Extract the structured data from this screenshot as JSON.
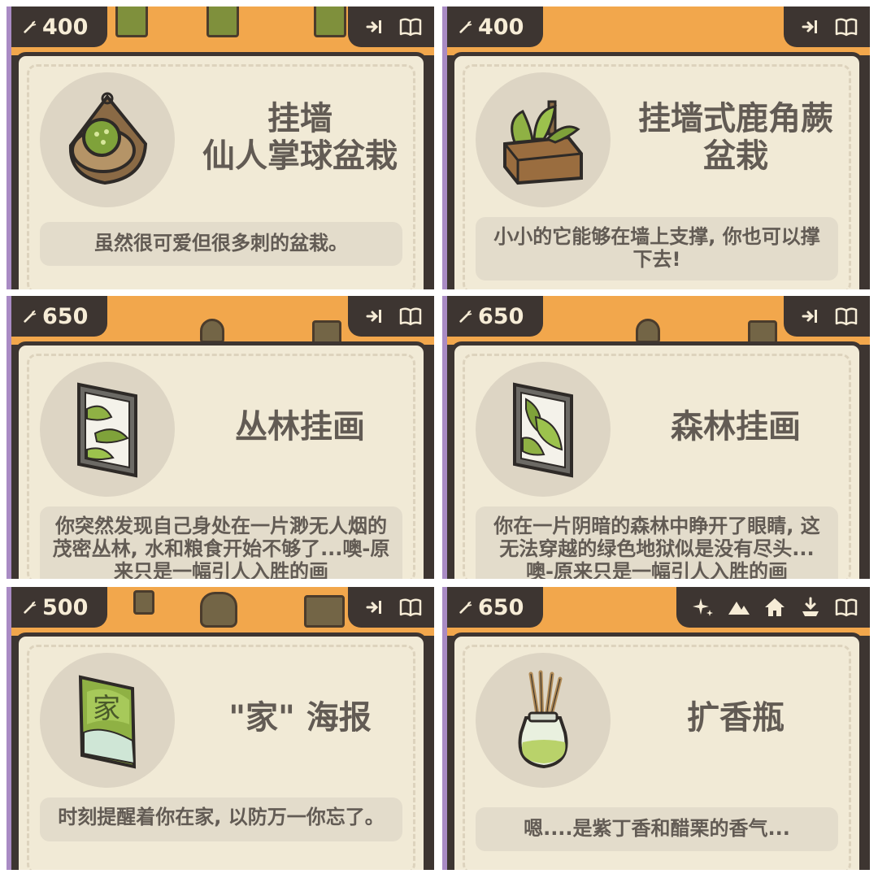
{
  "panels": [
    {
      "price": "400",
      "title_lines": [
        "挂墙",
        "仙人掌球盆栽"
      ],
      "description": "虽然很可爱但很多刺的盆栽。",
      "actions": [
        "pin-icon",
        "book-icon"
      ],
      "image": "hanging-cactus-planter"
    },
    {
      "price": "400",
      "title_lines": [
        "挂墙式鹿角蕨",
        "盆栽"
      ],
      "description": "小小的它能够在墙上支撑, 你也可以撑下去!",
      "actions": [
        "pin-icon",
        "book-icon"
      ],
      "image": "staghorn-fern-crate"
    },
    {
      "price": "650",
      "title_lines": [
        "丛林挂画"
      ],
      "description": "你突然发现自己身处在一片渺无人烟的茂密丛林, 水和粮食开始不够了...噢-原来只是一幅引人入胜的画",
      "actions": [
        "pin-icon",
        "book-icon"
      ],
      "image": "jungle-painting"
    },
    {
      "price": "650",
      "title_lines": [
        "森林挂画"
      ],
      "description": "你在一片阴暗的森林中睁开了眼睛, 这无法穿越的绿色地狱似是没有尽头...噢-原来只是一幅引人入胜的画",
      "actions": [
        "pin-icon",
        "book-icon"
      ],
      "image": "forest-painting"
    },
    {
      "price": "500",
      "title_lines": [
        "\"家\" 海报"
      ],
      "description": "时刻提醒着你在家, 以防万一你忘了。",
      "actions": [
        "pin-icon",
        "book-icon"
      ],
      "image": "home-poster",
      "poster_char": "家"
    },
    {
      "price": "650",
      "title_lines": [
        "扩香瓶"
      ],
      "description": "嗯....是紫丁香和醋栗的香气...",
      "actions": [
        "sparkle-icon",
        "mountain-icon",
        "home-icon",
        "pin-icon",
        "book-icon"
      ],
      "image": "reed-diffuser"
    }
  ],
  "colors": {
    "frame": "#3d3531",
    "orange": "#f2a74c",
    "card": "#f1ead6",
    "text": "#625b54",
    "price_text": "#f6ecd6",
    "side_accent": "#a98bc4"
  }
}
